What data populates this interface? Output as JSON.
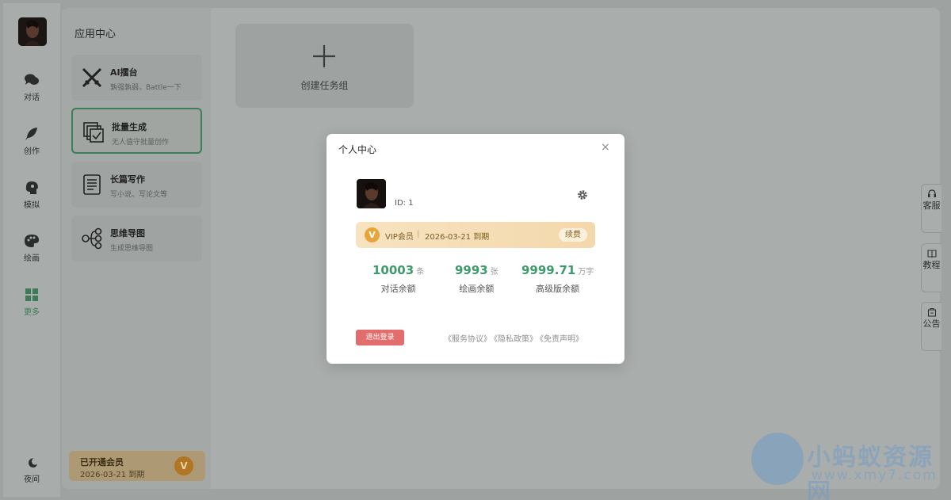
{
  "rail": {
    "items": [
      {
        "label": "对话",
        "icon": "chat-icon"
      },
      {
        "label": "创作",
        "icon": "feather-icon"
      },
      {
        "label": "模拟",
        "icon": "head-icon"
      },
      {
        "label": "绘画",
        "icon": "palette-icon"
      },
      {
        "label": "更多",
        "icon": "grid-icon",
        "active": true
      }
    ],
    "night_label": "夜间"
  },
  "apps": {
    "title": "应用中心",
    "cards": [
      {
        "title": "AI擂台",
        "subtitle": "孰强孰弱，Battle一下",
        "icon": "swords-icon"
      },
      {
        "title": "批量生成",
        "subtitle": "无人值守批量创作",
        "icon": "batch-icon"
      },
      {
        "title": "长篇写作",
        "subtitle": "写小说、写论文等",
        "icon": "document-icon"
      },
      {
        "title": "思维导图",
        "subtitle": "生成思维导图",
        "icon": "mindmap-icon"
      }
    ]
  },
  "create_group": {
    "label": "创建任务组"
  },
  "vip_bar": {
    "title": "已开通会员",
    "expiry": "2026-03-21 到期",
    "badge": "V"
  },
  "side_tabs": [
    {
      "label": "客服",
      "icon": "headset-icon"
    },
    {
      "label": "教程",
      "icon": "book-icon"
    },
    {
      "label": "公告",
      "icon": "notice-icon"
    }
  ],
  "watermark": {
    "text": "小蚂蚁资源网",
    "url": "www.xmy7.com"
  },
  "modal": {
    "title": "个人中心",
    "close": "×",
    "user_id": "ID: 1",
    "vip": {
      "badge": "V",
      "label": "VIP会员",
      "separator": "|",
      "expiry": "2026-03-21 到期",
      "renew": "续费"
    },
    "stats": [
      {
        "value": "10003",
        "unit": "条",
        "caption": "对话余额"
      },
      {
        "value": "9993",
        "unit": "张",
        "caption": "绘画余额"
      },
      {
        "value": "9999.71",
        "unit": "万字",
        "caption": "高级版余额"
      }
    ],
    "logout": "退出登录",
    "links": [
      "《服务协议》",
      "《隐私政策》",
      "《免责声明》"
    ]
  },
  "colors": {
    "accent": "#3d9a6a",
    "danger": "#e36c6c",
    "vip_gold": "#e6a43a"
  }
}
